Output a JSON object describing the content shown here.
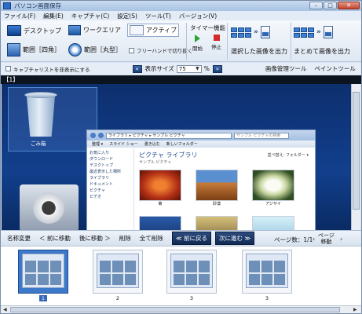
{
  "window": {
    "title": "パソコン画面保存"
  },
  "window_buttons": {
    "minimize": "–",
    "maximize": "□",
    "close": "✕"
  },
  "menu": [
    "ファイル(F)",
    "編集(E)",
    "キャプチャ(C)",
    "設定(S)",
    "ツール(T)",
    "バージョン(V)"
  ],
  "toolbar": {
    "desktop": "デスクトップ",
    "work_area": "ワークエリア",
    "active": "アクティブ",
    "range_rect": "範囲［四角］",
    "range_circle": "範囲［丸型］",
    "freehand": "フリーハンドで切り抜く",
    "timer_label": "タイマー機能",
    "start": "開始",
    "stop": "停止",
    "output_selected": "選択した画像を出力",
    "output_all": "まとめて画像を出力"
  },
  "options": {
    "hide_capture_list": "キャプチャリストを非表示にする",
    "display_size_label": "表示サイズ",
    "display_size_value": "75",
    "percent": "%",
    "image_tools": "画像管理ツール",
    "paint_tool": "ペイントツール"
  },
  "pane_header": "【1】",
  "preview": {
    "recycle_label": "ごみ箱",
    "explorer_address": "ライブラリ ▸ ピクチャ ▸ サンプル ピクチャ",
    "explorer_search": "サンプル ピクチャの検索",
    "explorer_cmd": [
      "整理 ▾",
      "スライド ショー",
      "書き込む",
      "新しいフォルダー"
    ],
    "sidebar": [
      "お気に入り",
      "ダウンロード",
      "デスクトップ",
      "最近表示した場所",
      "",
      "ライブラリ",
      "ドキュメント",
      "ピクチャ",
      "ビデオ"
    ],
    "library_title": "ピクチャ ライブラリ",
    "library_sub": "サンプル ピクチャ",
    "arrange": "並べ替え: フォルダー ▾",
    "photos": [
      "菊",
      "砂漠",
      "アジサイ",
      "",
      "",
      ""
    ]
  },
  "controls": {
    "rename": "名称変更",
    "prev_move": "＜ 前に移動",
    "next_move": "後に移動 ＞",
    "delete": "削除",
    "delete_all": "全て削除",
    "back": "≪ 前に戻る",
    "forward": "次に進む ≫",
    "page_count": "ページ数：1/1",
    "page_move": "ページ\n移動"
  },
  "thumbnails": [
    {
      "num": "1",
      "selected": true
    },
    {
      "num": "2",
      "selected": false
    },
    {
      "num": "3",
      "selected": false
    },
    {
      "num": "3",
      "selected": false
    }
  ],
  "colors": {
    "accent": "#3d78c9",
    "dark_button": "#1c3d75",
    "title_bar": "#a8c3e4"
  }
}
